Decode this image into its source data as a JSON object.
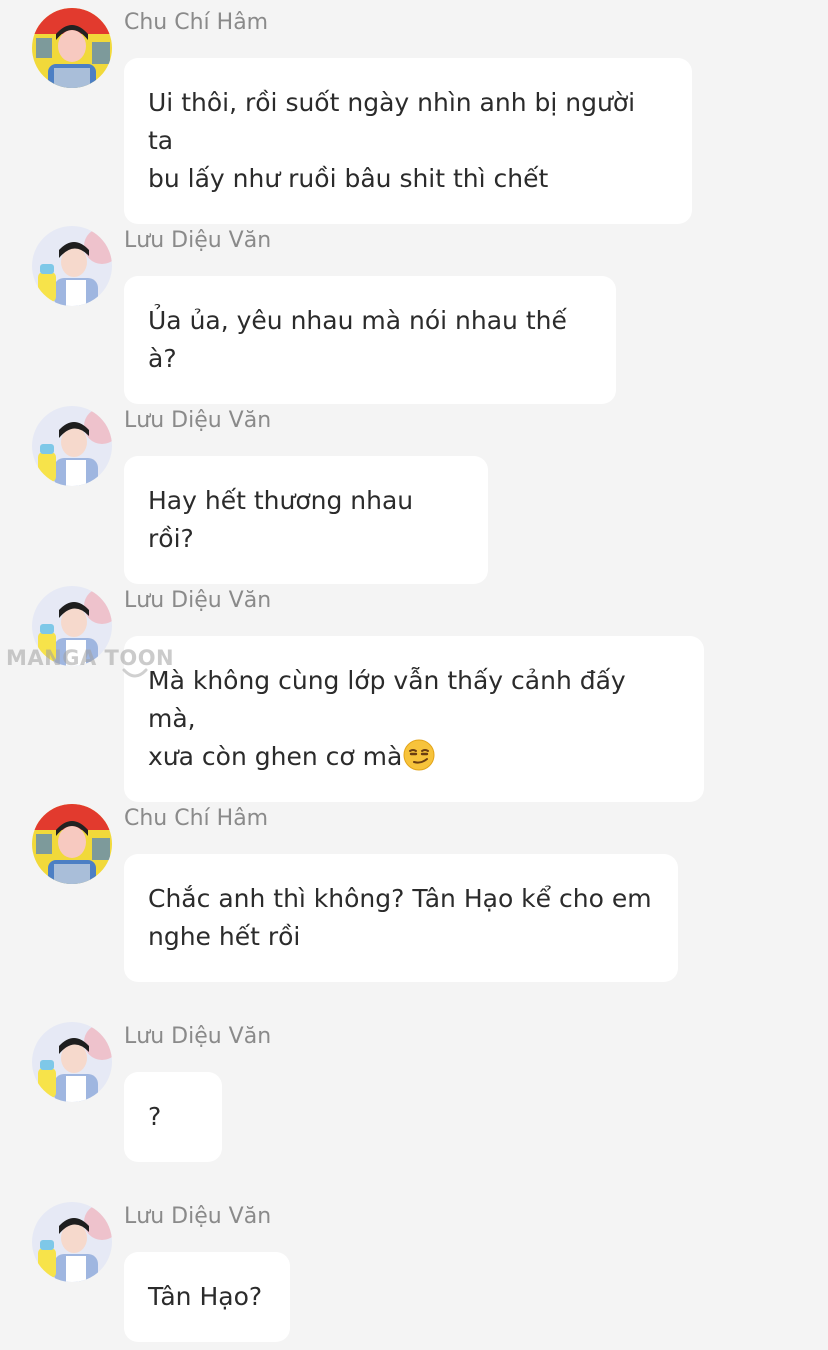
{
  "watermark": "MANGA TOON",
  "participants": {
    "chu_chi_ham": {
      "name": "Chu Chí Hâm",
      "avatar_colors": [
        "#f1d93a",
        "#e23a2e",
        "#4c7fc4",
        "#f7c9c0"
      ]
    },
    "luu_dieu_van": {
      "name": "Lưu Diệu Văn",
      "avatar_colors": [
        "#e6e9f5",
        "#f0b8c2",
        "#f7e34a",
        "#9fb6e0"
      ]
    }
  },
  "messages": [
    {
      "sender": "Chu Chí Hâm",
      "avatar": "chu_chi_ham",
      "lines": [
        "Ui thôi, rồi suốt ngày nhìn anh bị người ta",
        "bu lấy như ruồi bâu shit thì chết"
      ]
    },
    {
      "sender": "Lưu Diệu Văn",
      "avatar": "luu_dieu_van",
      "lines": [
        "Ủa ủa, yêu nhau mà nói nhau thế à?"
      ]
    },
    {
      "sender": "Lưu Diệu Văn",
      "avatar": "luu_dieu_van",
      "lines": [
        "Hay hết thương nhau rồi?"
      ]
    },
    {
      "sender": "Lưu Diệu Văn",
      "avatar": "luu_dieu_van",
      "lines": [
        "Mà không cùng lớp vẫn thấy cảnh đấy mà,",
        "xưa còn ghen cơ mà"
      ],
      "emoji": "smirking-face"
    },
    {
      "sender": "Chu Chí Hâm",
      "avatar": "chu_chi_ham",
      "lines": [
        "Chắc anh thì không? Tân Hạo kể cho em",
        "nghe hết rồi"
      ]
    },
    {
      "sender": "Lưu Diệu Văn",
      "avatar": "luu_dieu_van",
      "lines": [
        "?"
      ]
    },
    {
      "sender": "Lưu Diệu Văn",
      "avatar": "luu_dieu_van",
      "lines": [
        "Tân Hạo?"
      ]
    }
  ]
}
